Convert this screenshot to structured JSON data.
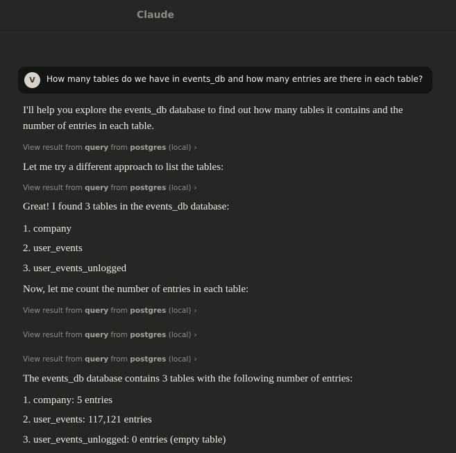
{
  "app": {
    "title": "Claude"
  },
  "user_message": {
    "avatar_initial": "V",
    "text": "How many tables do we have in events_db and how many entries are there in each table?"
  },
  "assistant": {
    "intro_line1": "I'll help you explore the events_db database to find out how many tables it contains and the",
    "intro_line2": "number of entries in each table.",
    "tool_call_text": {
      "prefix": "View result from ",
      "tool": "query",
      "middle": " from ",
      "server": "postgres",
      "suffix": " (local)"
    },
    "retry_text": "Let me try a different approach to list the tables:",
    "found_text": "Great! I found 3 tables in the events_db database:",
    "tables": [
      "1. company",
      "2. user_events",
      "3. user_events_unlogged"
    ],
    "count_intro": "Now, let me count the number of entries in each table:",
    "summary_text": "The events_db database contains 3 tables with the following number of entries:",
    "counts": [
      "1. company: 5 entries",
      "2. user_events: 117,121 entries",
      "3. user_events_unlogged: 0 entries (empty table)"
    ]
  },
  "colors": {
    "background": "#262624",
    "user_bubble": "#141413",
    "text": "#ece9e2",
    "muted": "#8f8d86"
  }
}
